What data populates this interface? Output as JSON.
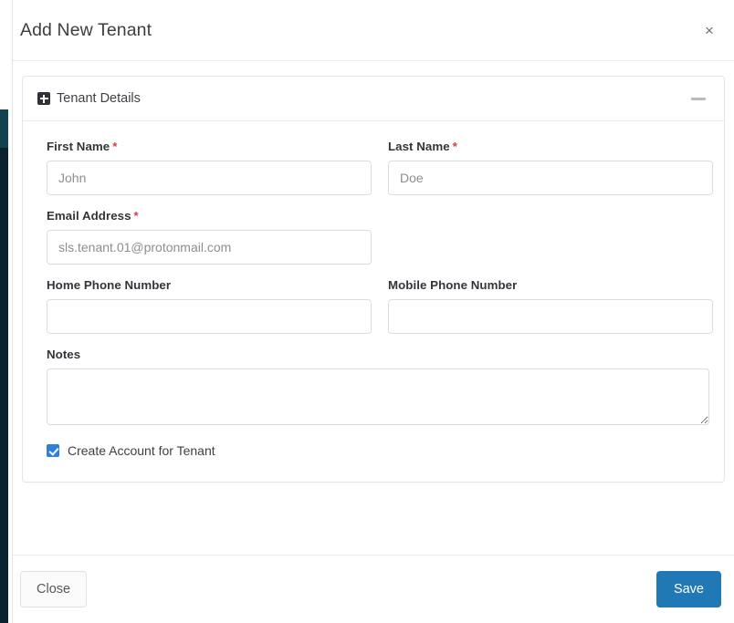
{
  "modal": {
    "title": "Add New Tenant",
    "close_icon": "close-icon",
    "close_icon_glyph": "×"
  },
  "card": {
    "title": "Tenant Details",
    "expand_icon": "plus-square-icon",
    "collapse_icon": "minus-icon"
  },
  "fields": {
    "first_name": {
      "label": "First Name",
      "required_marker": "*",
      "value": "",
      "placeholder": "John"
    },
    "last_name": {
      "label": "Last Name",
      "required_marker": "*",
      "value": "",
      "placeholder": "Doe"
    },
    "email": {
      "label": "Email Address",
      "required_marker": "*",
      "value": "",
      "placeholder": "sls.tenant.01@protonmail.com"
    },
    "home_phone": {
      "label": "Home Phone Number",
      "value": "",
      "placeholder": ""
    },
    "mobile_phone": {
      "label": "Mobile Phone Number",
      "value": "",
      "placeholder": ""
    },
    "notes": {
      "label": "Notes",
      "value": "",
      "placeholder": ""
    }
  },
  "checkbox": {
    "label": "Create Account for Tenant",
    "checked": true
  },
  "footer": {
    "close_label": "Close",
    "save_label": "Save"
  },
  "colors": {
    "save_button": "#2079b5",
    "checkbox_accent": "#2d7fe0",
    "required_star": "#d23f4d",
    "sidebar": "#0b2330"
  }
}
